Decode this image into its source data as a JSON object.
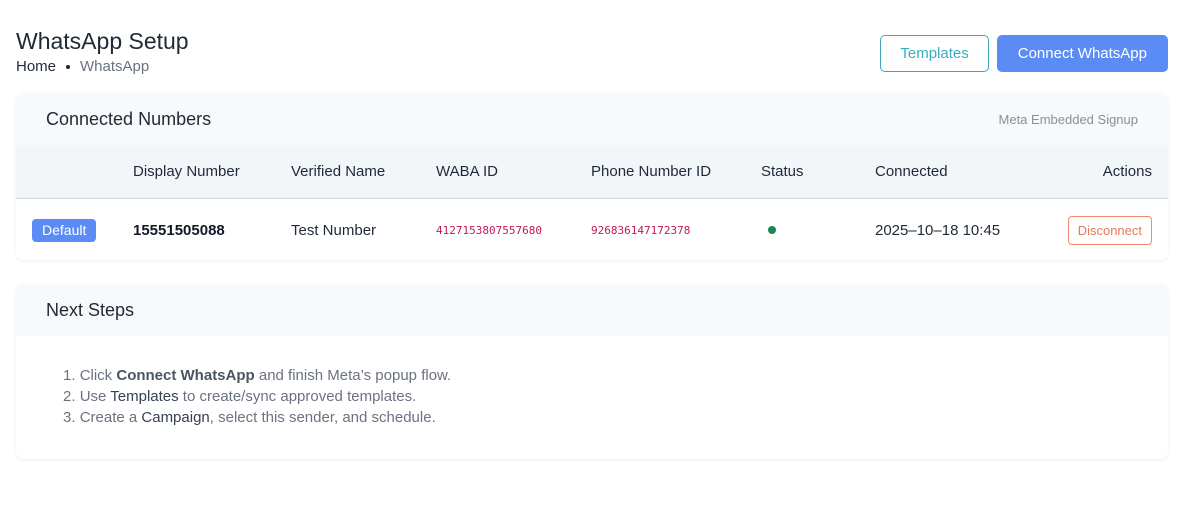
{
  "header": {
    "title": "WhatsApp Setup",
    "breadcrumb": {
      "home": "Home",
      "current": "WhatsApp"
    },
    "templates_label": "Templates",
    "connect_label": "Connect WhatsApp"
  },
  "numbers_card": {
    "title": "Connected Numbers",
    "subtitle": "Meta Embedded Signup",
    "columns": [
      "Display Number",
      "Verified Name",
      "WABA ID",
      "Phone Number ID",
      "Status",
      "Connected",
      "Actions"
    ],
    "rows": [
      {
        "badge": "Default",
        "display_number": "15551505088",
        "verified_name": "Test Number",
        "waba_id": "4127153807557680",
        "phone_number_id": "926836147172378",
        "status": "active",
        "connected": "2025–10–18 10:45",
        "action_label": "Disconnect"
      }
    ]
  },
  "steps_card": {
    "title": "Next Steps",
    "steps": [
      {
        "num": "1.",
        "pre": "Click ",
        "strong": "Connect WhatsApp",
        "post": " and finish Meta’s popup flow."
      },
      {
        "num": "2.",
        "pre": "Use ",
        "strong": "Templates",
        "post": " to create/sync approved templates."
      },
      {
        "num": "3.",
        "pre": "Create a ",
        "strong": "Campaign",
        "post": ", select this sender, and schedule."
      }
    ]
  },
  "colors": {
    "primary": "#5b8cf5",
    "outline": "#3aaec0",
    "danger": "#e8795a",
    "status_active": "#198754",
    "id_text": "#c2185b"
  }
}
